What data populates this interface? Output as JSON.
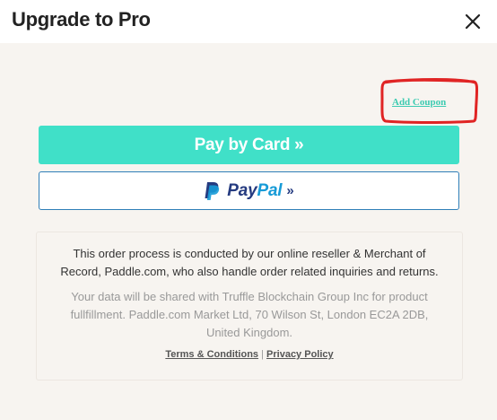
{
  "header": {
    "title": "Upgrade to Pro"
  },
  "coupon": {
    "label": "Add Coupon"
  },
  "buttons": {
    "pay_by_card": "Pay by Card »",
    "paypal_pay": "Pay",
    "paypal_pal": "Pal",
    "paypal_arrow": "»"
  },
  "info": {
    "main": "This order process is conducted by our online reseller & Merchant of Record, Paddle.com, who also handle order related inquiries and returns.",
    "sub": "Your data will be shared with Truffle Blockchain Group Inc for product fullfillment. Paddle.com Market Ltd, 70 Wilson St, London EC2A 2DB, United Kingdom.",
    "terms": "Terms & Conditions",
    "separator": "|",
    "privacy": "Privacy Policy"
  },
  "colors": {
    "accent": "#40e0c8",
    "link": "#3dcbb1",
    "annotation": "#e02424",
    "paypal_dark": "#253b80",
    "paypal_light": "#179bd7"
  },
  "icons": {
    "close": "close-icon",
    "paypal": "paypal-icon"
  }
}
